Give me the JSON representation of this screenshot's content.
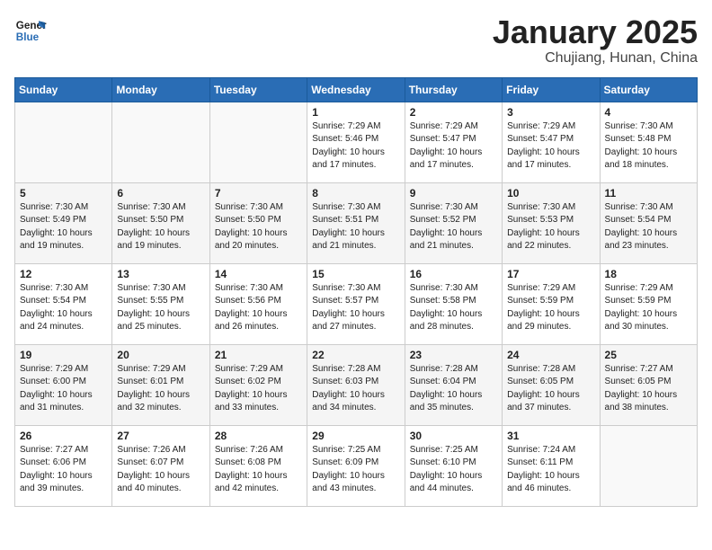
{
  "header": {
    "logo_line1": "General",
    "logo_line2": "Blue",
    "title": "January 2025",
    "subtitle": "Chujiang, Hunan, China"
  },
  "days_of_week": [
    "Sunday",
    "Monday",
    "Tuesday",
    "Wednesday",
    "Thursday",
    "Friday",
    "Saturday"
  ],
  "weeks": [
    [
      {
        "day": "",
        "info": ""
      },
      {
        "day": "",
        "info": ""
      },
      {
        "day": "",
        "info": ""
      },
      {
        "day": "1",
        "info": "Sunrise: 7:29 AM\nSunset: 5:46 PM\nDaylight: 10 hours\nand 17 minutes."
      },
      {
        "day": "2",
        "info": "Sunrise: 7:29 AM\nSunset: 5:47 PM\nDaylight: 10 hours\nand 17 minutes."
      },
      {
        "day": "3",
        "info": "Sunrise: 7:29 AM\nSunset: 5:47 PM\nDaylight: 10 hours\nand 17 minutes."
      },
      {
        "day": "4",
        "info": "Sunrise: 7:30 AM\nSunset: 5:48 PM\nDaylight: 10 hours\nand 18 minutes."
      }
    ],
    [
      {
        "day": "5",
        "info": "Sunrise: 7:30 AM\nSunset: 5:49 PM\nDaylight: 10 hours\nand 19 minutes."
      },
      {
        "day": "6",
        "info": "Sunrise: 7:30 AM\nSunset: 5:50 PM\nDaylight: 10 hours\nand 19 minutes."
      },
      {
        "day": "7",
        "info": "Sunrise: 7:30 AM\nSunset: 5:50 PM\nDaylight: 10 hours\nand 20 minutes."
      },
      {
        "day": "8",
        "info": "Sunrise: 7:30 AM\nSunset: 5:51 PM\nDaylight: 10 hours\nand 21 minutes."
      },
      {
        "day": "9",
        "info": "Sunrise: 7:30 AM\nSunset: 5:52 PM\nDaylight: 10 hours\nand 21 minutes."
      },
      {
        "day": "10",
        "info": "Sunrise: 7:30 AM\nSunset: 5:53 PM\nDaylight: 10 hours\nand 22 minutes."
      },
      {
        "day": "11",
        "info": "Sunrise: 7:30 AM\nSunset: 5:54 PM\nDaylight: 10 hours\nand 23 minutes."
      }
    ],
    [
      {
        "day": "12",
        "info": "Sunrise: 7:30 AM\nSunset: 5:54 PM\nDaylight: 10 hours\nand 24 minutes."
      },
      {
        "day": "13",
        "info": "Sunrise: 7:30 AM\nSunset: 5:55 PM\nDaylight: 10 hours\nand 25 minutes."
      },
      {
        "day": "14",
        "info": "Sunrise: 7:30 AM\nSunset: 5:56 PM\nDaylight: 10 hours\nand 26 minutes."
      },
      {
        "day": "15",
        "info": "Sunrise: 7:30 AM\nSunset: 5:57 PM\nDaylight: 10 hours\nand 27 minutes."
      },
      {
        "day": "16",
        "info": "Sunrise: 7:30 AM\nSunset: 5:58 PM\nDaylight: 10 hours\nand 28 minutes."
      },
      {
        "day": "17",
        "info": "Sunrise: 7:29 AM\nSunset: 5:59 PM\nDaylight: 10 hours\nand 29 minutes."
      },
      {
        "day": "18",
        "info": "Sunrise: 7:29 AM\nSunset: 5:59 PM\nDaylight: 10 hours\nand 30 minutes."
      }
    ],
    [
      {
        "day": "19",
        "info": "Sunrise: 7:29 AM\nSunset: 6:00 PM\nDaylight: 10 hours\nand 31 minutes."
      },
      {
        "day": "20",
        "info": "Sunrise: 7:29 AM\nSunset: 6:01 PM\nDaylight: 10 hours\nand 32 minutes."
      },
      {
        "day": "21",
        "info": "Sunrise: 7:29 AM\nSunset: 6:02 PM\nDaylight: 10 hours\nand 33 minutes."
      },
      {
        "day": "22",
        "info": "Sunrise: 7:28 AM\nSunset: 6:03 PM\nDaylight: 10 hours\nand 34 minutes."
      },
      {
        "day": "23",
        "info": "Sunrise: 7:28 AM\nSunset: 6:04 PM\nDaylight: 10 hours\nand 35 minutes."
      },
      {
        "day": "24",
        "info": "Sunrise: 7:28 AM\nSunset: 6:05 PM\nDaylight: 10 hours\nand 37 minutes."
      },
      {
        "day": "25",
        "info": "Sunrise: 7:27 AM\nSunset: 6:05 PM\nDaylight: 10 hours\nand 38 minutes."
      }
    ],
    [
      {
        "day": "26",
        "info": "Sunrise: 7:27 AM\nSunset: 6:06 PM\nDaylight: 10 hours\nand 39 minutes."
      },
      {
        "day": "27",
        "info": "Sunrise: 7:26 AM\nSunset: 6:07 PM\nDaylight: 10 hours\nand 40 minutes."
      },
      {
        "day": "28",
        "info": "Sunrise: 7:26 AM\nSunset: 6:08 PM\nDaylight: 10 hours\nand 42 minutes."
      },
      {
        "day": "29",
        "info": "Sunrise: 7:25 AM\nSunset: 6:09 PM\nDaylight: 10 hours\nand 43 minutes."
      },
      {
        "day": "30",
        "info": "Sunrise: 7:25 AM\nSunset: 6:10 PM\nDaylight: 10 hours\nand 44 minutes."
      },
      {
        "day": "31",
        "info": "Sunrise: 7:24 AM\nSunset: 6:11 PM\nDaylight: 10 hours\nand 46 minutes."
      },
      {
        "day": "",
        "info": ""
      }
    ]
  ]
}
